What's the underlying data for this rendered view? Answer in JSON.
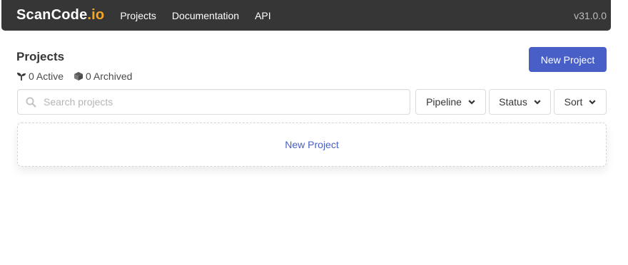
{
  "navbar": {
    "brand_main": "ScanCode",
    "brand_suffix": ".io",
    "links": [
      "Projects",
      "Documentation",
      "API"
    ],
    "version": "v31.0.0"
  },
  "header": {
    "title": "Projects",
    "active_label": "0 Active",
    "archived_label": "0 Archived",
    "new_project_label": "New Project"
  },
  "filters": {
    "search_placeholder": "Search projects",
    "pipeline_label": "Pipeline",
    "status_label": "Status",
    "sort_label": "Sort"
  },
  "empty_state": {
    "link_label": "New Project"
  },
  "colors": {
    "navbar_bg": "#363636",
    "brand_accent": "#f6a623",
    "primary": "#485fc7"
  },
  "icons": [
    "seedling-icon",
    "cube-icon",
    "search-icon",
    "chevron-down-icon"
  ]
}
